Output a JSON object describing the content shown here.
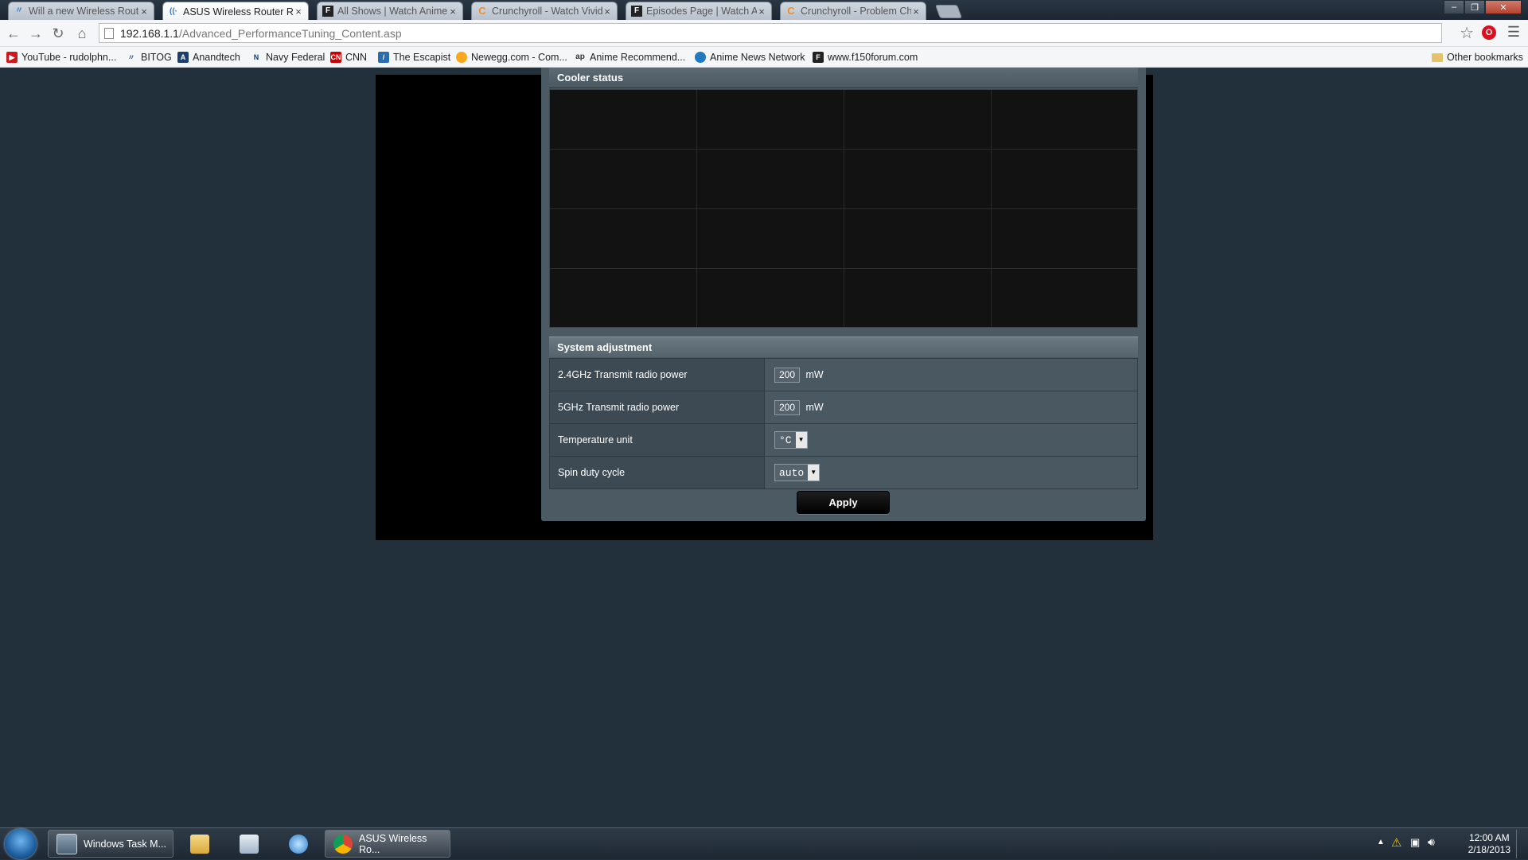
{
  "browser": {
    "tabs": [
      {
        "title": "Will a new Wireless Router",
        "icon": "wifi-favicon",
        "active": false
      },
      {
        "title": "ASUS Wireless Router RT-N",
        "icon": "wifi-favicon",
        "active": true
      },
      {
        "title": "All Shows | Watch Anime",
        "icon": "f-favicon",
        "active": false
      },
      {
        "title": "Crunchyroll - Watch Vivid",
        "icon": "crunchyroll-favicon",
        "active": false
      },
      {
        "title": "Episodes Page | Watch An",
        "icon": "f-favicon",
        "active": false
      },
      {
        "title": "Crunchyroll - Problem Ch",
        "icon": "crunchyroll-favicon",
        "active": false
      }
    ],
    "url_host": "192.168.1.1",
    "url_path": "/Advanced_PerformanceTuning_Content.asp",
    "bookmarks": [
      {
        "label": "YouTube - rudolphn...",
        "icon": "youtube-icon",
        "color": "#cc181e"
      },
      {
        "label": "BITOG",
        "icon": "bitog-icon",
        "color": "#3b5a9a"
      },
      {
        "label": "Anandtech",
        "icon": "anandtech-icon",
        "color": "#1c3f6e"
      },
      {
        "label": "Navy Federal",
        "icon": "navy-federal-icon",
        "color": "#0b3a7e"
      },
      {
        "label": "CNN",
        "icon": "cnn-icon",
        "color": "#cc0000"
      },
      {
        "label": "The Escapist",
        "icon": "escapist-icon",
        "color": "#2b6cb0"
      },
      {
        "label": "Newegg.com - Com...",
        "icon": "newegg-icon",
        "color": "#f7a81b"
      },
      {
        "label": "Anime Recommend...",
        "icon": "ap-icon",
        "color": "#333333"
      },
      {
        "label": "Anime News Network",
        "icon": "ann-icon",
        "color": "#1f7ac2"
      },
      {
        "label": "www.f150forum.com",
        "icon": "f150-icon",
        "color": "#222222"
      }
    ],
    "other_bookmarks": "Other bookmarks"
  },
  "router": {
    "cooler_status_title": "Cooler status",
    "system_adjustment_title": "System adjustment",
    "settings": [
      {
        "label": "2.4GHz Transmit radio power",
        "type": "number",
        "value": "200",
        "unit": "mW"
      },
      {
        "label": "5GHz Transmit radio power",
        "type": "number",
        "value": "200",
        "unit": "mW"
      },
      {
        "label": "Temperature unit",
        "type": "select",
        "value": "°C"
      },
      {
        "label": "Spin duty cycle",
        "type": "select",
        "value": "auto"
      }
    ],
    "apply_label": "Apply"
  },
  "taskbar": {
    "tasks": [
      {
        "label": "Windows Task M...",
        "icon": "task-manager-icon"
      },
      {
        "label": "ASUS Wireless Ro...",
        "icon": "chrome-icon"
      }
    ],
    "clock_time": "12:00 AM",
    "clock_date": "2/18/2013"
  }
}
